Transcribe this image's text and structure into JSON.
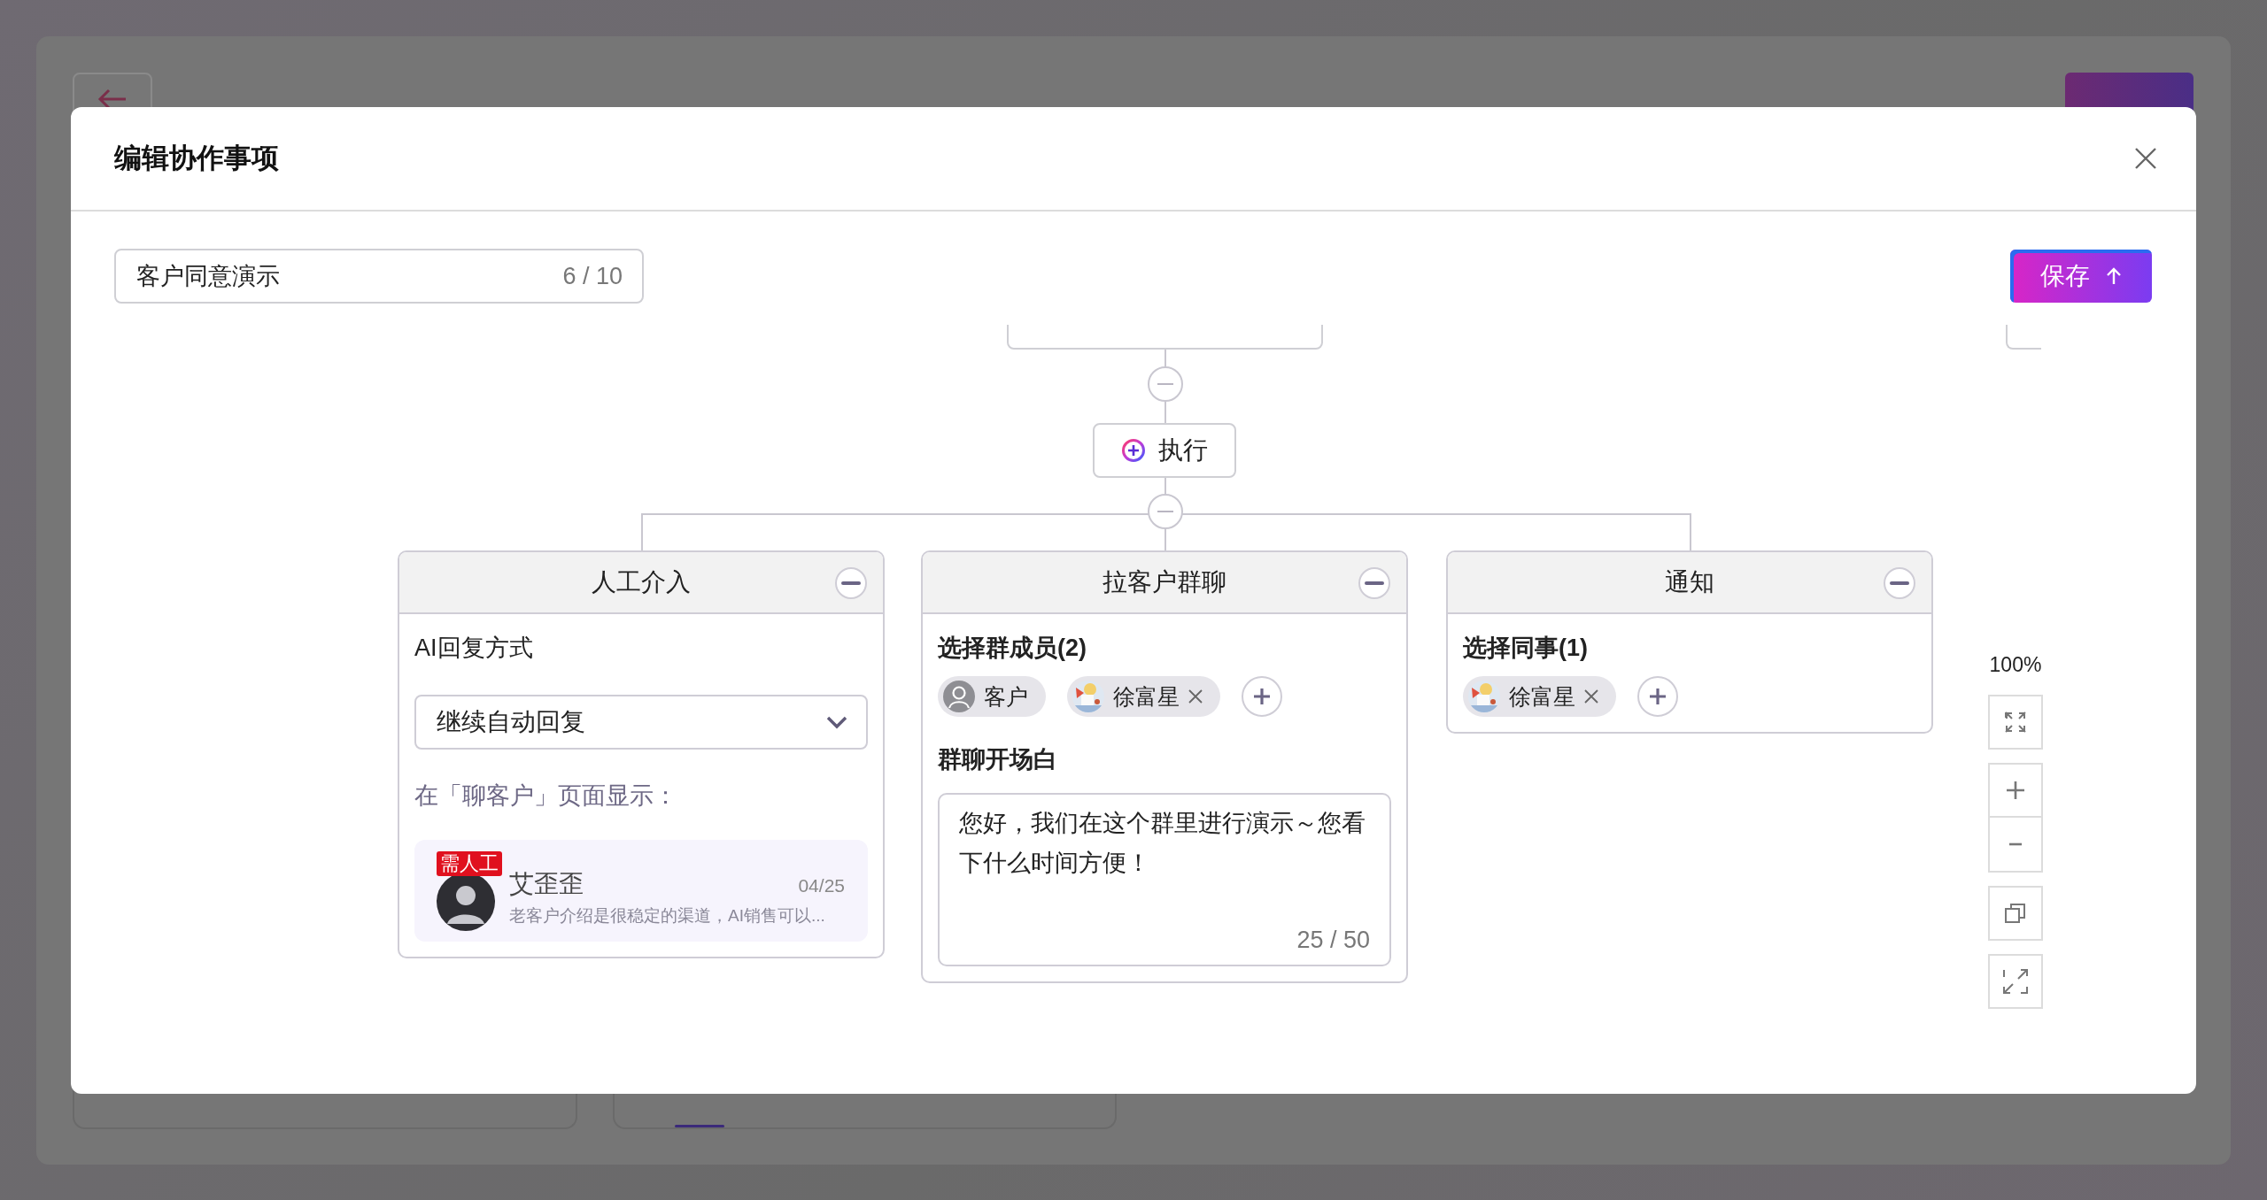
{
  "dialog": {
    "title": "编辑协作事项",
    "name_field": {
      "value": "客户同意演示",
      "counter": "6 / 10"
    },
    "save_label": "保存"
  },
  "flow": {
    "action_node": {
      "label": "执行"
    },
    "branches": [
      {
        "kind": "manual",
        "title": "人工介入",
        "field_label": "AI回复方式",
        "select_value": "继续自动回复",
        "preview_label": "在「聊客户」页面显示：",
        "preview": {
          "badge": "需人工",
          "name": "艾歪歪",
          "date": "04/25",
          "message": "老客户介绍是很稳定的渠道，AI销售可以..."
        }
      },
      {
        "kind": "group_chat",
        "title": "拉客户群聊",
        "members_label": "选择群成员(2)",
        "members": [
          {
            "name": "客户",
            "kind": "customer",
            "removable": false
          },
          {
            "name": "徐富星",
            "kind": "colleague",
            "removable": true
          }
        ],
        "opening_label": "群聊开场白",
        "opening": {
          "value": "您好，我们在这个群里进行演示～您看下什么时间方便！",
          "counter": "25 / 50"
        }
      },
      {
        "kind": "notify",
        "title": "通知",
        "members_label": "选择同事(1)",
        "members": [
          {
            "name": "徐富星",
            "kind": "colleague",
            "removable": true
          }
        ]
      }
    ]
  },
  "zoom": {
    "level_text": "100%"
  }
}
